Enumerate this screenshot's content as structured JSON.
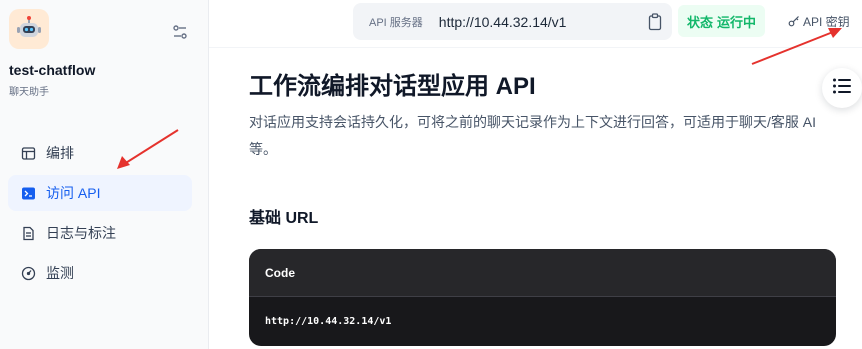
{
  "sidebar": {
    "app_name": "test-chatflow",
    "app_type": "聊天助手",
    "items": [
      {
        "label": "编排",
        "icon": "layout-icon",
        "active": false
      },
      {
        "label": "访问 API",
        "icon": "terminal-icon",
        "active": true
      },
      {
        "label": "日志与标注",
        "icon": "document-icon",
        "active": false
      },
      {
        "label": "监测",
        "icon": "gauge-icon",
        "active": false
      }
    ]
  },
  "header": {
    "api_server_label": "API 服务器",
    "api_server_url": "http://10.44.32.14/v1",
    "status_label": "状态",
    "status_value": "运行中",
    "api_key_label": "API 密钥"
  },
  "main": {
    "title": "工作流编排对话型应用 API",
    "description": "对话应用支持会话持久化，可将之前的聊天记录作为上下文进行回答，可适用于聊天/客服 AI 等。",
    "base_url_title": "基础 URL",
    "code_header": "Code",
    "code_content": "http://10.44.32.14/v1"
  },
  "colors": {
    "accent": "#155eef",
    "active_bg": "#eff4ff",
    "status_green": "#12b76a",
    "annotation_arrow": "#e5322d"
  }
}
